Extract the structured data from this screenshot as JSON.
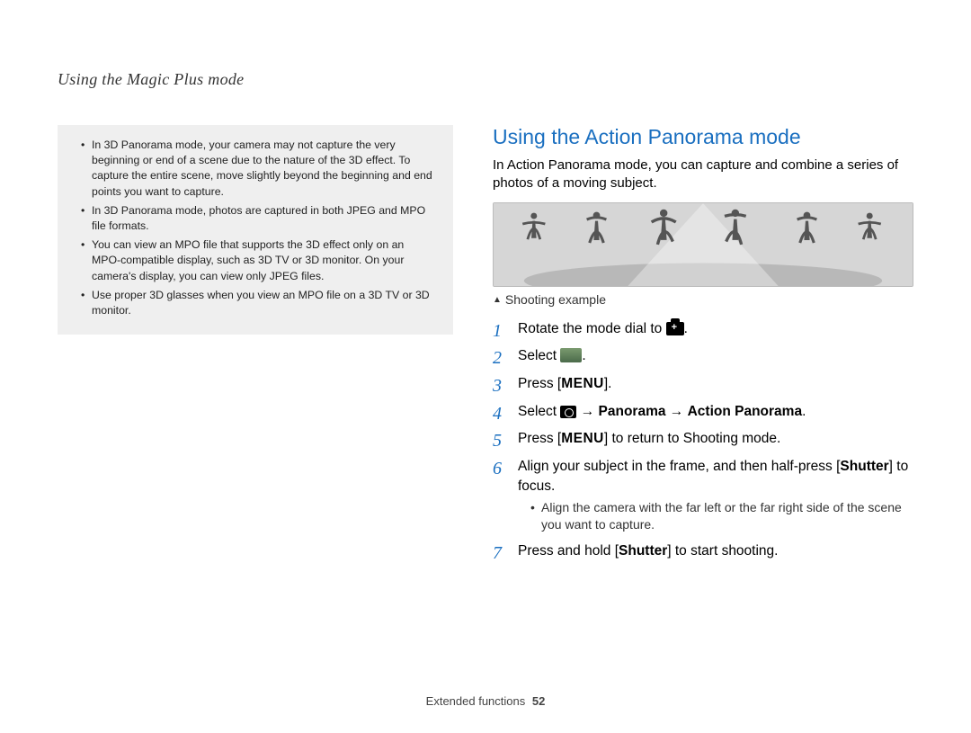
{
  "header": {
    "running_head": "Using the Magic Plus mode"
  },
  "left": {
    "notes": [
      "In 3D Panorama mode, your camera may not capture the very beginning or end of a scene due to the nature of the 3D effect. To capture the entire scene, move slightly beyond the beginning and end points you want to capture.",
      "In 3D Panorama mode, photos are captured in both JPEG and MPO file formats.",
      "You can view an MPO file that supports the 3D effect only on an MPO-compatible display, such as 3D TV or 3D monitor. On your camera's display, you can view only JPEG files.",
      "Use proper 3D glasses when you view an MPO file on a 3D TV or 3D monitor."
    ]
  },
  "right": {
    "title": "Using the Action Panorama mode",
    "intro": "In Action Panorama mode, you can capture and combine a series of photos of a moving subject.",
    "caption": "Shooting example",
    "steps": {
      "s1_pre": "Rotate the mode dial to ",
      "s1_post": ".",
      "s2_pre": "Select ",
      "s2_post": ".",
      "s3_pre": "Press [",
      "s3_menu": "MENU",
      "s3_post": "].",
      "s4_pre": "Select ",
      "s4_arrow1": " → ",
      "s4_b1": "Panorama",
      "s4_arrow2": " → ",
      "s4_b2": "Action Panorama",
      "s4_post": ".",
      "s5_pre": "Press [",
      "s5_menu": "MENU",
      "s5_post": "] to return to Shooting mode.",
      "s6_pre": "Align your subject in the frame, and then half-press [",
      "s6_b": "Shutter",
      "s6_post": "] to focus.",
      "s6_sub": "Align the camera with the far left or the far right side of the scene you want to capture.",
      "s7_pre": "Press and hold [",
      "s7_b": "Shutter",
      "s7_post": "] to start shooting."
    }
  },
  "footer": {
    "section": "Extended functions",
    "page": "52"
  }
}
